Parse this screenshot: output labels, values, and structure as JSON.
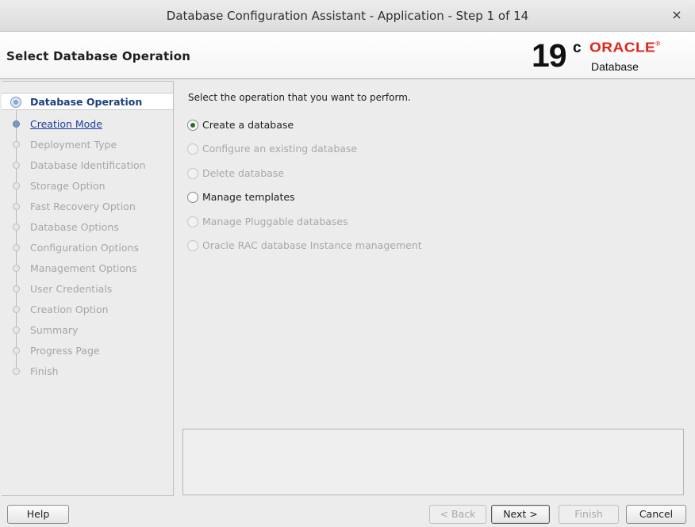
{
  "window": {
    "title": "Database Configuration Assistant - Application - Step 1 of 14",
    "close_glyph": "×"
  },
  "header": {
    "page_title": "Select Database Operation",
    "brand": {
      "version": "19",
      "version_sup": "c",
      "vendor": "ORACLE",
      "vendor_mark": "®",
      "product": "Database",
      "accent_color": "#e2231a"
    }
  },
  "nav": {
    "items": [
      {
        "label": "Database Operation",
        "state": "active"
      },
      {
        "label": "Creation Mode",
        "state": "link"
      },
      {
        "label": "Deployment Type",
        "state": "disabled"
      },
      {
        "label": "Database Identification",
        "state": "disabled"
      },
      {
        "label": "Storage Option",
        "state": "disabled"
      },
      {
        "label": "Fast Recovery Option",
        "state": "disabled"
      },
      {
        "label": "Database Options",
        "state": "disabled"
      },
      {
        "label": "Configuration Options",
        "state": "disabled"
      },
      {
        "label": "Management Options",
        "state": "disabled"
      },
      {
        "label": "User Credentials",
        "state": "disabled"
      },
      {
        "label": "Creation Option",
        "state": "disabled"
      },
      {
        "label": "Summary",
        "state": "disabled"
      },
      {
        "label": "Progress Page",
        "state": "disabled"
      },
      {
        "label": "Finish",
        "state": "disabled"
      }
    ]
  },
  "main": {
    "prompt": "Select the operation that you want to perform.",
    "options": [
      {
        "label": "Create a database",
        "checked": true,
        "enabled": true
      },
      {
        "label": "Configure an existing database",
        "checked": false,
        "enabled": false
      },
      {
        "label": "Delete database",
        "checked": false,
        "enabled": false
      },
      {
        "label": "Manage templates",
        "checked": false,
        "enabled": true
      },
      {
        "label": "Manage Pluggable databases",
        "checked": false,
        "enabled": false
      },
      {
        "label": "Oracle RAC database Instance management",
        "checked": false,
        "enabled": false
      }
    ],
    "description": ""
  },
  "footer": {
    "help_label": "Help",
    "back_label": "< Back",
    "next_label": "Next >",
    "finish_label": "Finish",
    "cancel_label": "Cancel"
  }
}
